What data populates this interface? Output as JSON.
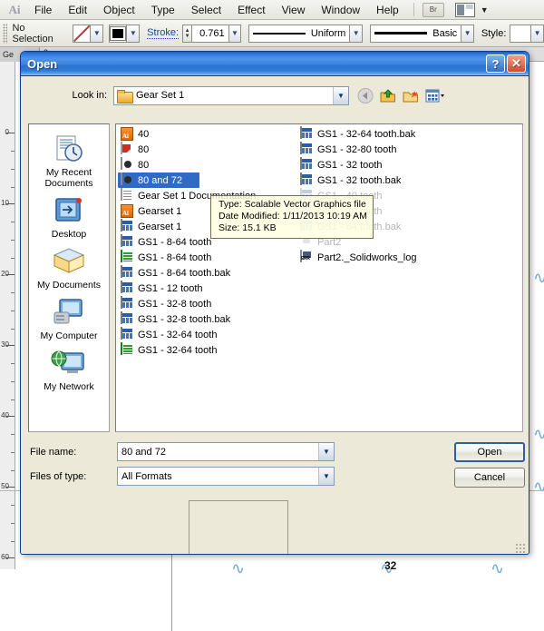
{
  "app": {
    "logo": "Ai",
    "menus": [
      "File",
      "Edit",
      "Object",
      "Type",
      "Select",
      "Effect",
      "View",
      "Window",
      "Help"
    ],
    "bridge_button": "Br",
    "control_bar": {
      "selection_status": "No Selection",
      "fill_icon": "none-swatch-icon",
      "stroke_icon": "black-swatch-icon",
      "stroke_label": "Stroke:",
      "stroke_value": "0.761",
      "profile_value": "Uniform",
      "brush_value": "Basic",
      "style_label": "Style:",
      "style_value": ""
    },
    "ruler_v_labels": [
      "0",
      "10",
      "20",
      "30",
      "40",
      "50",
      "60"
    ],
    "ruler_tab_label": "Ge",
    "ruler_h_label": "2",
    "canvas_bottom_number": "32"
  },
  "dialog": {
    "title": "Open",
    "help_button": "?",
    "close_button": "✕",
    "lookin": {
      "label": "Look in:",
      "value": "Gear Set 1",
      "folder_icon": "folder-icon",
      "caret_icon": "chevron-down-icon"
    },
    "nav_buttons": [
      {
        "name": "back-button",
        "icon": "back-arrow-icon"
      },
      {
        "name": "up-one-level-button",
        "icon": "up-folder-icon"
      },
      {
        "name": "new-folder-button",
        "icon": "new-folder-icon"
      },
      {
        "name": "views-button",
        "icon": "views-grid-icon"
      }
    ],
    "places": [
      {
        "label": "My Recent Documents",
        "icon": "recent-documents-icon"
      },
      {
        "label": "Desktop",
        "icon": "desktop-icon"
      },
      {
        "label": "My Documents",
        "icon": "my-documents-icon"
      },
      {
        "label": "My Computer",
        "icon": "my-computer-icon"
      },
      {
        "label": "My Network",
        "icon": "my-network-icon"
      }
    ],
    "files_column_1": [
      {
        "name": "40",
        "icon": "ai-file-icon",
        "selected": false,
        "ghost": false
      },
      {
        "name": "80",
        "icon": "pdf-file-icon",
        "selected": false,
        "ghost": false
      },
      {
        "name": "80",
        "icon": "svg-file-icon",
        "selected": false,
        "ghost": false
      },
      {
        "name": "80 and 72",
        "icon": "svg-file-icon",
        "selected": true,
        "ghost": false
      },
      {
        "name": "Gear Set 1 Documentation",
        "icon": "text-file-icon",
        "selected": false,
        "ghost": false
      },
      {
        "name": "Gearset 1",
        "icon": "ai-file-icon",
        "selected": false,
        "ghost": false
      },
      {
        "name": "Gearset 1",
        "icon": "xls-file-icon",
        "selected": false,
        "ghost": false
      },
      {
        "name": "GS1 - 8-64 tooth",
        "icon": "xls-file-icon",
        "selected": false,
        "ghost": false
      },
      {
        "name": "GS1 - 8-64 tooth",
        "icon": "green-file-icon",
        "selected": false,
        "ghost": false
      },
      {
        "name": "GS1 - 8-64 tooth.bak",
        "icon": "xls-file-icon",
        "selected": false,
        "ghost": false
      },
      {
        "name": "GS1 - 12 tooth",
        "icon": "xls-file-icon",
        "selected": false,
        "ghost": false
      },
      {
        "name": "GS1 - 32-8 tooth",
        "icon": "xls-file-icon",
        "selected": false,
        "ghost": false
      },
      {
        "name": "GS1 - 32-8 tooth.bak",
        "icon": "xls-file-icon",
        "selected": false,
        "ghost": false
      },
      {
        "name": "GS1 - 32-64 tooth",
        "icon": "xls-file-icon",
        "selected": false,
        "ghost": false
      },
      {
        "name": "GS1 - 32-64 tooth",
        "icon": "green-file-icon",
        "selected": false,
        "ghost": false
      }
    ],
    "files_column_2": [
      {
        "name": "GS1 - 32-64 tooth.bak",
        "icon": "xls-file-icon",
        "selected": false,
        "ghost": false
      },
      {
        "name": "GS1 - 32-80 tooth",
        "icon": "xls-file-icon",
        "selected": false,
        "ghost": false
      },
      {
        "name": "GS1 - 32 tooth",
        "icon": "xls-file-icon",
        "selected": false,
        "ghost": false
      },
      {
        "name": "GS1 - 32 tooth.bak",
        "icon": "xls-file-icon",
        "selected": false,
        "ghost": false
      },
      {
        "name": "GS1 - 40 tooth",
        "icon": "xls-file-icon",
        "selected": false,
        "ghost": true
      },
      {
        "name": "GS1 - 64 tooth",
        "icon": "xls-file-icon",
        "selected": false,
        "ghost": true
      },
      {
        "name": "GS1 - 64 tooth.bak",
        "icon": "xls-file-icon",
        "selected": false,
        "ghost": true
      },
      {
        "name": "Part2",
        "icon": "part-file-icon",
        "selected": false,
        "ghost": true
      },
      {
        "name": "Part2._Solidworks_log",
        "icon": "error-log-icon",
        "selected": false,
        "ghost": false
      }
    ],
    "tooltip": {
      "type_line": "Type: Scalable Vector Graphics file",
      "date_line": "Date Modified: 1/11/2013 10:19 AM",
      "size_line": "Size: 15.1 KB"
    },
    "filename": {
      "label": "File name:",
      "value": "80 and 72",
      "caret_icon": "chevron-down-icon"
    },
    "filetype": {
      "label": "Files of type:",
      "value": "All Formats",
      "caret_icon": "chevron-down-icon"
    },
    "buttons": {
      "open": "Open",
      "cancel": "Cancel"
    }
  },
  "colors": {
    "title_bar_blue": "#2f7ad9",
    "dialog_face": "#ece9d8",
    "selection_blue": "#316ac5",
    "tooltip_bg": "#ffffe1",
    "close_red": "#cf4b28"
  }
}
